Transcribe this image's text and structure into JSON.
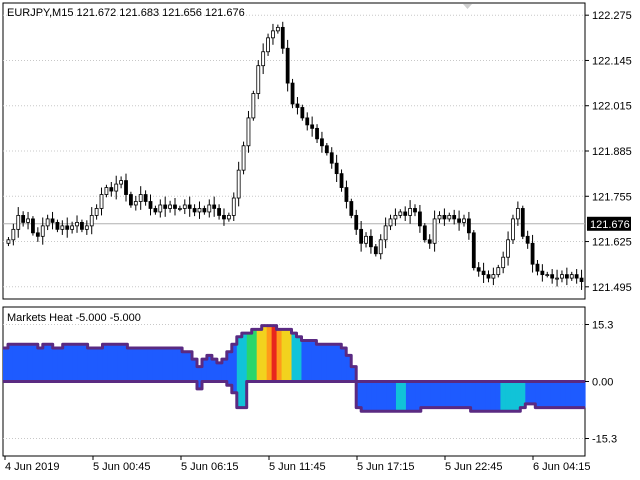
{
  "symbol_line": "EURJPY,M15  121.672 121.683 121.656 121.676",
  "indicator_line": "Markets Heat -5.000 -5.000",
  "price_axis": {
    "labels": [
      "122.275",
      "122.145",
      "122.015",
      "121.885",
      "121.755",
      "121.625",
      "121.495"
    ],
    "values": [
      122.275,
      122.145,
      122.015,
      121.885,
      121.755,
      121.625,
      121.495
    ],
    "current_price_label": "121.676",
    "current_price": 121.676
  },
  "indicator_axis": {
    "labels": [
      "15.3",
      "0.00",
      "-15.3"
    ],
    "values": [
      15.3,
      0.0,
      -15.3
    ]
  },
  "time_axis": {
    "labels": [
      "4 Jun 2019",
      "5 Jun 00:45",
      "5 Jun 06:15",
      "5 Jun 11:45",
      "5 Jun 17:15",
      "5 Jun 22:45",
      "6 Jun 04:15"
    ]
  },
  "colors": {
    "background": "#ffffff",
    "grid": "#c8c8c8",
    "candles": "#000000",
    "heat_outline": "#5a2a82",
    "heat_base": "#1a4fd0",
    "heat_blue": "#1e5bff",
    "heat_cyan": "#11c3d8",
    "heat_green": "#2ad66b",
    "heat_yellow": "#f2d21e",
    "heat_orange": "#ff9a1a",
    "heat_red": "#e8261d",
    "current_price_line": "#b0b0b0"
  },
  "chart_data": {
    "type": "candlestick",
    "y_range": [
      121.46,
      122.31
    ],
    "closes": [
      121.63,
      121.66,
      121.7,
      121.68,
      121.69,
      121.65,
      121.64,
      121.67,
      121.69,
      121.68,
      121.66,
      121.67,
      121.66,
      121.67,
      121.68,
      121.66,
      121.67,
      121.7,
      121.72,
      121.76,
      121.78,
      121.77,
      121.79,
      121.8,
      121.76,
      121.73,
      121.74,
      121.76,
      121.74,
      121.72,
      121.71,
      121.73,
      121.72,
      121.73,
      121.72,
      121.72,
      121.73,
      121.72,
      121.71,
      121.72,
      121.71,
      121.73,
      121.72,
      121.7,
      121.69,
      121.7,
      121.75,
      121.83,
      121.9,
      121.98,
      122.05,
      122.13,
      122.17,
      122.21,
      122.23,
      122.24,
      122.18,
      122.08,
      122.02,
      122.01,
      121.98,
      121.96,
      121.95,
      121.92,
      121.9,
      121.88,
      121.85,
      121.82,
      121.78,
      121.74,
      121.7,
      121.66,
      121.62,
      121.64,
      121.61,
      121.59,
      121.63,
      121.67,
      121.69,
      121.7,
      121.71,
      121.7,
      121.72,
      121.71,
      121.67,
      121.63,
      121.62,
      121.69,
      121.7,
      121.69,
      121.7,
      121.69,
      121.68,
      121.69,
      121.65,
      121.55,
      121.54,
      121.53,
      121.52,
      121.53,
      121.55,
      121.58,
      121.63,
      121.69,
      121.72,
      121.64,
      121.62,
      121.56,
      121.54,
      121.53,
      121.53,
      121.52,
      121.52,
      121.53,
      121.52,
      121.53,
      121.52,
      121.51
    ],
    "heat_upper": [
      9,
      10,
      10,
      10,
      10,
      10,
      10,
      9,
      10,
      10,
      9,
      9,
      10,
      10,
      10,
      10,
      10,
      9,
      9,
      9,
      10,
      10,
      10,
      10,
      10,
      9,
      9,
      9,
      9,
      9,
      9,
      9,
      9,
      9,
      9,
      9,
      8,
      8,
      6,
      4,
      6,
      7,
      6,
      5,
      6,
      8,
      10,
      12,
      13,
      13,
      14,
      14,
      15,
      15,
      15,
      14,
      14,
      14,
      13,
      12,
      11,
      11,
      11,
      10,
      10,
      10,
      10,
      10,
      9,
      7,
      4,
      0,
      0,
      0,
      0,
      0,
      0,
      0,
      0,
      0,
      0,
      0,
      0,
      0,
      0,
      0,
      0,
      0,
      0,
      0,
      0,
      0,
      0,
      0,
      0,
      0,
      0,
      0,
      0,
      0,
      0,
      0,
      0,
      0,
      0,
      0,
      0,
      0,
      0,
      0,
      0,
      0,
      0,
      0,
      0,
      0,
      0
    ],
    "heat_lower": [
      0,
      0,
      0,
      0,
      0,
      0,
      0,
      0,
      0,
      0,
      0,
      0,
      0,
      0,
      0,
      0,
      0,
      0,
      0,
      0,
      0,
      0,
      0,
      0,
      0,
      0,
      0,
      0,
      0,
      0,
      0,
      0,
      0,
      0,
      0,
      0,
      0,
      0,
      0,
      -2,
      0,
      0,
      0,
      0,
      0,
      -1,
      -3,
      -7,
      -7,
      0,
      0,
      0,
      0,
      0,
      0,
      0,
      0,
      0,
      0,
      0,
      0,
      0,
      0,
      0,
      0,
      0,
      0,
      0,
      0,
      0,
      0,
      -7,
      -8,
      -8,
      -8,
      -8,
      -8,
      -8,
      -8,
      -8,
      -8,
      -8,
      -8,
      -8,
      -7,
      -7,
      -7,
      -7,
      -7,
      -7,
      -7,
      -7,
      -7,
      -7,
      -8,
      -8,
      -8,
      -8,
      -8,
      -8,
      -8,
      -8,
      -8,
      -8,
      -7,
      -6,
      -6,
      -7,
      -7,
      -7,
      -7,
      -7,
      -7,
      -7,
      -7,
      -7,
      -7,
      -7,
      -7
    ],
    "heat_colors": [
      "blue",
      "blue",
      "blue",
      "blue",
      "blue",
      "blue",
      "blue",
      "blue",
      "blue",
      "blue",
      "blue",
      "blue",
      "blue",
      "blue",
      "blue",
      "blue",
      "blue",
      "blue",
      "blue",
      "blue",
      "blue",
      "blue",
      "blue",
      "blue",
      "blue",
      "blue",
      "blue",
      "blue",
      "blue",
      "blue",
      "blue",
      "blue",
      "blue",
      "blue",
      "blue",
      "blue",
      "blue",
      "blue",
      "blue",
      "blue",
      "blue",
      "blue",
      "blue",
      "blue",
      "blue",
      "blue",
      "blue",
      "cyan",
      "cyan",
      "green",
      "green",
      "yellow",
      "yellow",
      "orange",
      "red",
      "orange",
      "yellow",
      "yellow",
      "cyan",
      "cyan",
      "blue",
      "blue",
      "blue",
      "blue",
      "blue",
      "blue",
      "blue",
      "blue",
      "blue",
      "blue",
      "blue",
      "blue",
      "blue",
      "blue",
      "blue",
      "blue",
      "blue",
      "blue",
      "blue",
      "cyan",
      "cyan",
      "blue",
      "blue",
      "blue",
      "blue",
      "blue",
      "blue",
      "blue",
      "blue",
      "blue",
      "blue",
      "blue",
      "blue",
      "blue",
      "blue",
      "blue",
      "blue",
      "blue",
      "blue",
      "blue",
      "cyan",
      "cyan",
      "cyan",
      "cyan",
      "cyan",
      "blue",
      "blue",
      "blue",
      "blue",
      "blue",
      "blue",
      "blue",
      "blue",
      "blue",
      "blue",
      "blue",
      "blue",
      "blue",
      "blue"
    ]
  }
}
